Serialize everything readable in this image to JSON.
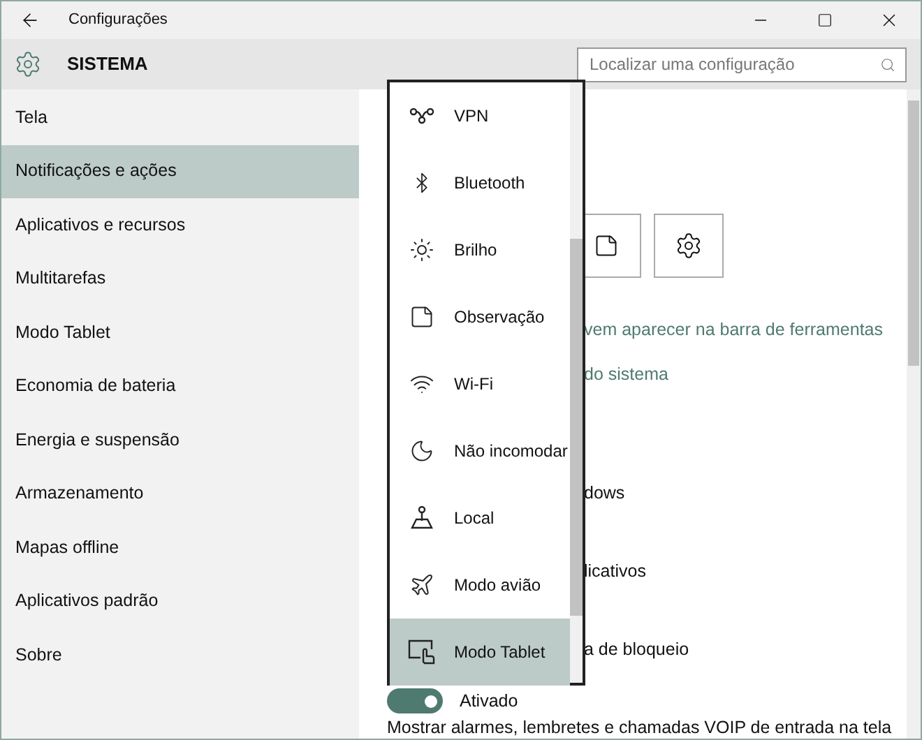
{
  "window": {
    "title": "Configurações"
  },
  "header": {
    "title": "SISTEMA",
    "search": {
      "placeholder": "Localizar uma configuração"
    }
  },
  "sidebar": {
    "items": [
      {
        "label": "Tela",
        "selected": false
      },
      {
        "label": "Notificações e ações",
        "selected": true
      },
      {
        "label": "Aplicativos e recursos",
        "selected": false
      },
      {
        "label": "Multitarefas",
        "selected": false
      },
      {
        "label": "Modo Tablet",
        "selected": false
      },
      {
        "label": "Economia de bateria",
        "selected": false
      },
      {
        "label": "Energia e suspensão",
        "selected": false
      },
      {
        "label": "Armazenamento",
        "selected": false
      },
      {
        "label": "Mapas offline",
        "selected": false
      },
      {
        "label": "Aplicativos padrão",
        "selected": false
      },
      {
        "label": "Sobre",
        "selected": false
      }
    ]
  },
  "content": {
    "links": [
      "vem aparecer na barra de ferramentas",
      "do sistema"
    ],
    "rows": [
      "dows",
      "licativos",
      "a de bloqueio"
    ],
    "toggle": {
      "on": true,
      "label": "Ativado"
    },
    "description": "Mostrar alarmes, lembretes e chamadas VOIP de entrada na tela"
  },
  "quick_action_menu": {
    "items": [
      {
        "label": "VPN",
        "selected": false
      },
      {
        "label": "Bluetooth",
        "selected": false
      },
      {
        "label": "Brilho",
        "selected": false
      },
      {
        "label": "Observação",
        "selected": false
      },
      {
        "label": "Wi-Fi",
        "selected": false
      },
      {
        "label": "Não incomodar",
        "selected": false
      },
      {
        "label": "Local",
        "selected": false
      },
      {
        "label": "Modo avião",
        "selected": false
      },
      {
        "label": "Modo Tablet",
        "selected": true
      }
    ]
  }
}
